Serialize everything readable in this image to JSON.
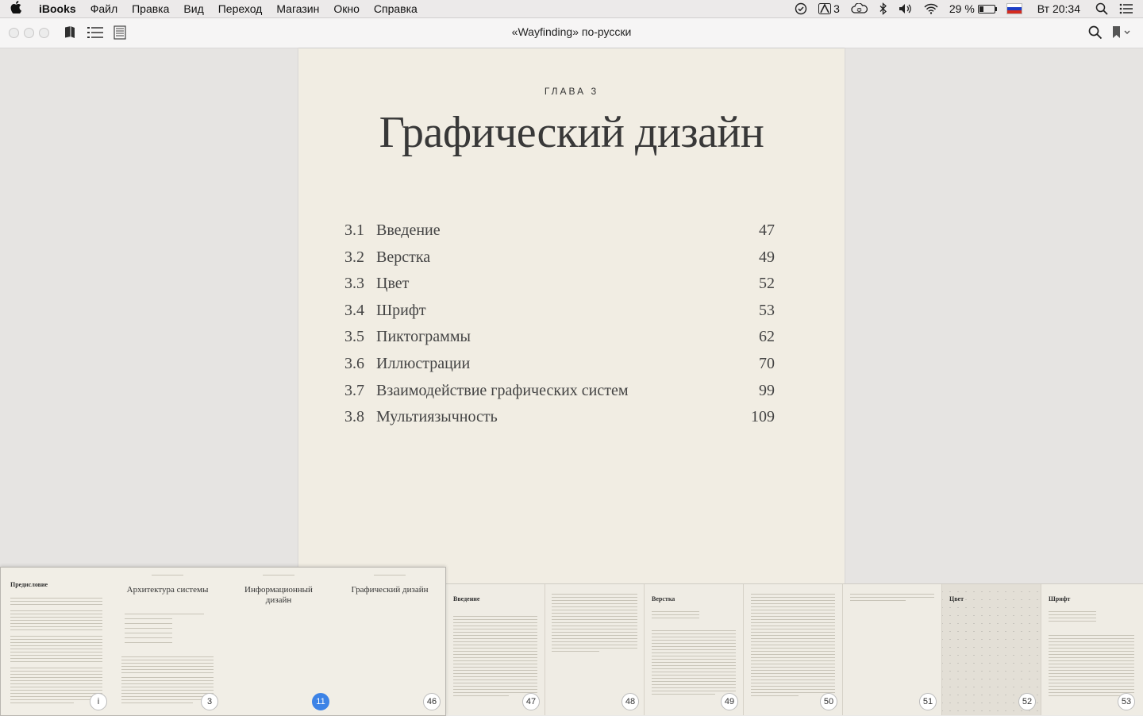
{
  "menubar": {
    "apple": "",
    "app": "iBooks",
    "items": [
      "Файл",
      "Правка",
      "Вид",
      "Переход",
      "Магазин",
      "Окно",
      "Справка"
    ],
    "status": {
      "adobe_count": "3",
      "battery": "29 %",
      "clock": "Вт 20:34"
    }
  },
  "toolbar": {
    "title": "«Wayfinding» по-русски"
  },
  "page": {
    "chapter_label": "ГЛАВА 3",
    "chapter_title": "Графический дизайн",
    "toc": [
      {
        "num": "3.1",
        "label": "Введение",
        "page": "47"
      },
      {
        "num": "3.2",
        "label": "Верстка",
        "page": "49"
      },
      {
        "num": "3.3",
        "label": "Цвет",
        "page": "52"
      },
      {
        "num": "3.4",
        "label": "Шрифт",
        "page": "53"
      },
      {
        "num": "3.5",
        "label": "Пиктограммы",
        "page": "62"
      },
      {
        "num": "3.6",
        "label": "Иллюстрации",
        "page": "70"
      },
      {
        "num": "3.7",
        "label": "Взаимодействие графических систем",
        "page": "99"
      },
      {
        "num": "3.8",
        "label": "Мультиязычность",
        "page": "109"
      }
    ]
  },
  "thumbnails": {
    "recent": [
      {
        "heading": "Предисловие",
        "badge": "i"
      },
      {
        "heading": "Архитектура системы",
        "badge": "3"
      },
      {
        "heading": "Информационный дизайн",
        "badge": "11"
      },
      {
        "heading": "Графический дизайн",
        "badge": "46"
      }
    ],
    "pages": [
      {
        "heading": "Введение",
        "badge": "47"
      },
      {
        "heading": "",
        "badge": "48"
      },
      {
        "heading": "Верстка",
        "badge": "49"
      },
      {
        "heading": "",
        "badge": "50"
      },
      {
        "heading": "",
        "badge": "51"
      },
      {
        "heading": "Цвет",
        "badge": "52"
      },
      {
        "heading": "Шрифт",
        "badge": "53"
      }
    ],
    "current_badge": "11"
  },
  "colors": {
    "page_bg": "#f1ede3",
    "active_badge": "#3d83e6"
  }
}
